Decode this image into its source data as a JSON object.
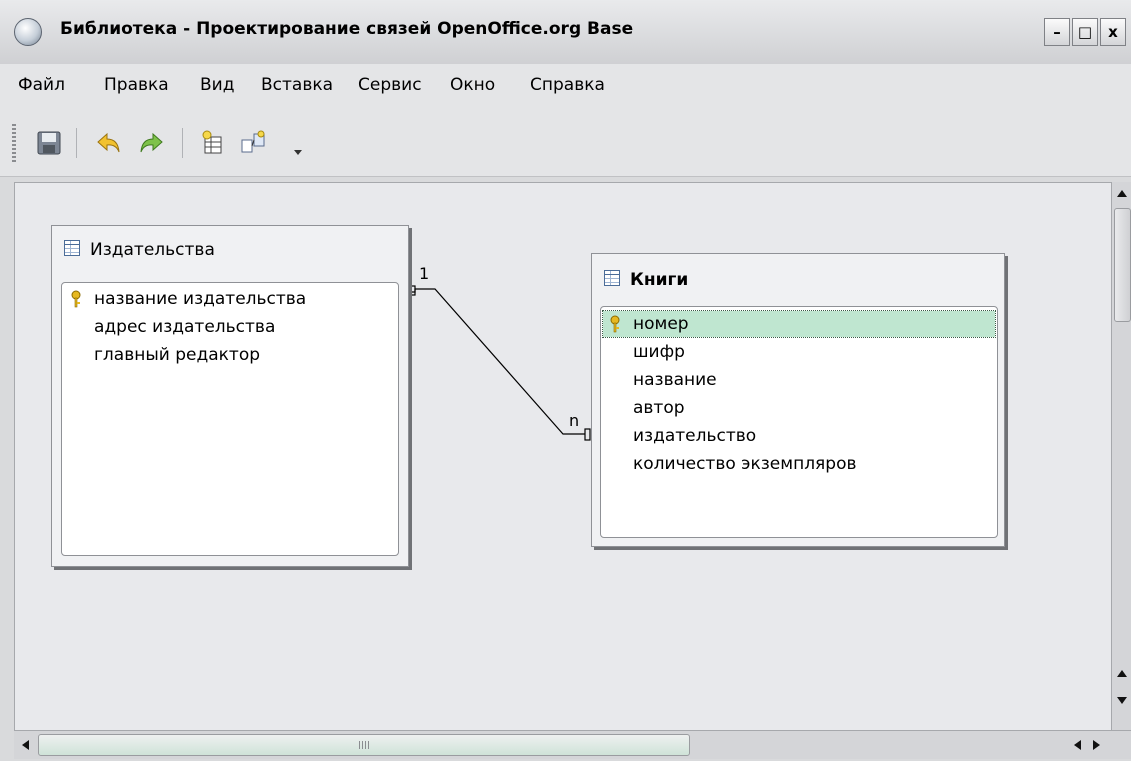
{
  "window": {
    "title": "Библиотека - Проектирование связей OpenOffice.org Base",
    "buttons": {
      "minimize": "–",
      "maximize": "□",
      "close": "x"
    }
  },
  "menu": [
    {
      "label": "Файл"
    },
    {
      "label": "Правка"
    },
    {
      "label": "Вид"
    },
    {
      "label": "Вставка"
    },
    {
      "label": "Сервис"
    },
    {
      "label": "Окно"
    },
    {
      "label": "Справка"
    }
  ],
  "toolbar": {
    "icons": [
      "save-icon",
      "undo-icon",
      "redo-icon",
      "new-table-icon",
      "new-relation-icon",
      "toolbar-options-icon"
    ]
  },
  "tables": [
    {
      "name": "Издательства",
      "fields": [
        {
          "label": "название издательства",
          "primary_key": true
        },
        {
          "label": "адрес издательства",
          "primary_key": false
        },
        {
          "label": "главный редактор",
          "primary_key": false
        }
      ]
    },
    {
      "name": "Книги",
      "fields": [
        {
          "label": "номер",
          "primary_key": true,
          "selected": true
        },
        {
          "label": "шифр",
          "primary_key": false
        },
        {
          "label": "название",
          "primary_key": false
        },
        {
          "label": "автор",
          "primary_key": false
        },
        {
          "label": "издательство",
          "primary_key": false
        },
        {
          "label": "количество экземпляров",
          "primary_key": false
        }
      ]
    }
  ],
  "relation": {
    "from_label": "1",
    "to_label": "n"
  },
  "colors": {
    "selected_row": "#bfe6d0",
    "key_icon": "#e6b820",
    "canvas": "#e8e9ec"
  }
}
